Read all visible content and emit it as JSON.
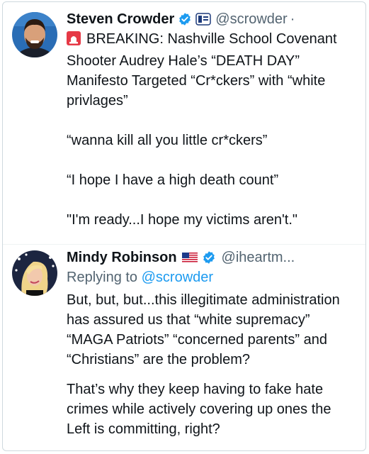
{
  "tweet1": {
    "name": "Steven Crowder",
    "handle": "@scrowder",
    "separator": "·",
    "line1": "BREAKING: Nashville School Covenant Shooter Audrey Hale’s “DEATH DAY” Manifesto Targeted “Cr*ckers” with “white privlages”",
    "line2": "“wanna kill all you little cr*ckers”",
    "line3": "“I hope I have a high death count”",
    "line4": "\"I'm ready...I hope my victims aren't.\"",
    "icons": [
      "verified-badge-icon",
      "org-affiliation-icon",
      "siren-emoji-icon"
    ]
  },
  "tweet2": {
    "name": "Mindy Robinson",
    "handle": "@iheartm...",
    "replying_prefix": "Replying to",
    "replying_handle": "@scrowder",
    "para1": "But, but, but...this illegitimate administration has assured us that “white supremacy” “MAGA Patriots” “concerned parents” and “Christians” are the problem?",
    "para2": "That’s why they keep having to fake hate crimes while actively covering up ones the Left is committing, right?",
    "icons": [
      "us-flag-icon",
      "verified-badge-icon"
    ]
  },
  "colors": {
    "text": "#0f1419",
    "secondary": "#536471",
    "link": "#1d9bf0",
    "verified": "#1d9bf0"
  }
}
